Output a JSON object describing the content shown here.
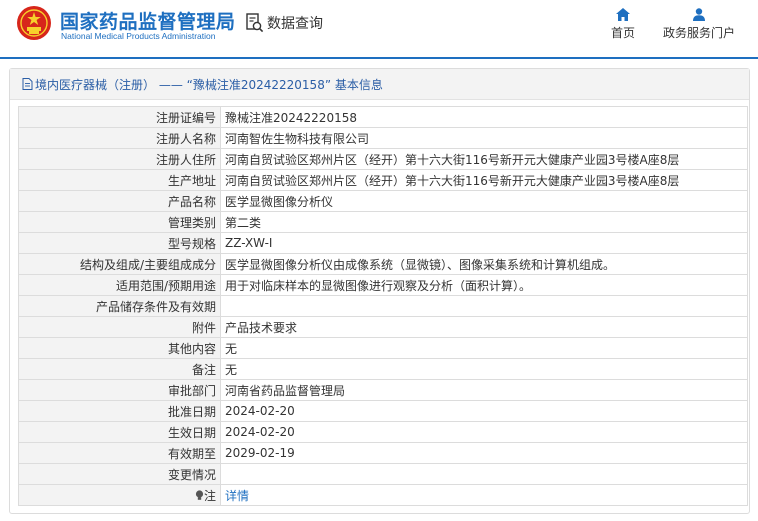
{
  "header": {
    "brand_cn": "国家药品监督管理局",
    "brand_en": "National Medical Products Administration",
    "data_query_label": "数据查询",
    "nav_home_label": "首页",
    "nav_gov_label": "政务服务门户",
    "accent_color": "#1e6fc0",
    "emblem_color": "#d7261b",
    "emblem_star_color": "#f7d02b"
  },
  "panel": {
    "title": "境内医疗器械（注册） —— “豫械注准20242220158” 基本信息",
    "rows": [
      {
        "label": "注册证编号",
        "value": "豫械注准20242220158"
      },
      {
        "label": "注册人名称",
        "value": "河南智佐生物科技有限公司"
      },
      {
        "label": "注册人住所",
        "value": "河南自贸试验区郑州片区（经开）第十六大街116号新开元大健康产业园3号楼A座8层"
      },
      {
        "label": "生产地址",
        "value": "河南自贸试验区郑州片区（经开）第十六大街116号新开元大健康产业园3号楼A座8层"
      },
      {
        "label": "产品名称",
        "value": "医学显微图像分析仪"
      },
      {
        "label": "管理类别",
        "value": "第二类"
      },
      {
        "label": "型号规格",
        "value": "ZZ-XW-I"
      },
      {
        "label": "结构及组成/主要组成成分",
        "value": "医学显微图像分析仪由成像系统（显微镜）、图像采集系统和计算机组成。"
      },
      {
        "label": "适用范围/预期用途",
        "value": "用于对临床样本的显微图像进行观察及分析（面积计算）。"
      },
      {
        "label": "产品储存条件及有效期",
        "value": ""
      },
      {
        "label": "附件",
        "value": "产品技术要求"
      },
      {
        "label": "其他内容",
        "value": "无"
      },
      {
        "label": "备注",
        "value": "无"
      },
      {
        "label": "审批部门",
        "value": "河南省药品监督管理局"
      },
      {
        "label": "批准日期",
        "value": "2024-02-20"
      },
      {
        "label": "生效日期",
        "value": "2024-02-20"
      },
      {
        "label": "有效期至",
        "value": "2029-02-19"
      },
      {
        "label": "变更情况",
        "value": ""
      }
    ],
    "note_label": "注",
    "note_link": "详情",
    "note_icon": "lightbulb-icon"
  }
}
